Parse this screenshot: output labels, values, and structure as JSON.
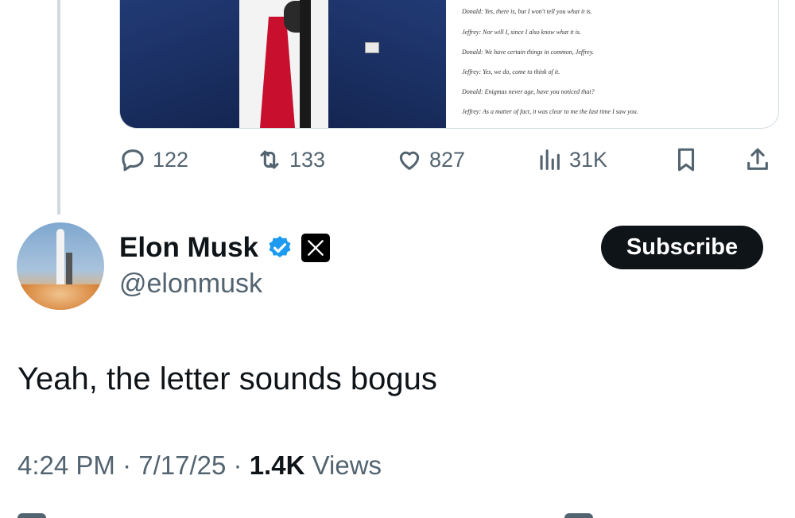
{
  "colors": {
    "text": "#0f1419",
    "secondary": "#536471",
    "verified": "#1d9bf0",
    "button_bg": "#0f1419"
  },
  "quoted_post": {
    "letter_lines": [
      "Donald: Yes, there is, but I won't tell you what it is.",
      "Jeffrey: Nor will I, since I also know what it is.",
      "Donald: We have certain things in common, Jeffrey.",
      "Jeffrey: Yes, we do, come to think of it.",
      "Donald: Enigmas never age, have you noticed that?",
      "Jeffrey: As a matter of fact, it was clear to me the last time I saw you."
    ],
    "actions": {
      "replies": "122",
      "reposts": "133",
      "likes": "827",
      "views": "31K"
    },
    "icons": [
      "reply-icon",
      "repost-icon",
      "like-icon",
      "views-icon",
      "bookmark-icon",
      "share-icon"
    ]
  },
  "post": {
    "author_name": "Elon Musk",
    "handle": "@elonmusk",
    "subscribe_label": "Subscribe",
    "text": "Yeah, the letter sounds bogus",
    "time": "4:24 PM",
    "date": "7/17/25",
    "views_count": "1.4K",
    "views_label": "Views",
    "separator": "·"
  }
}
